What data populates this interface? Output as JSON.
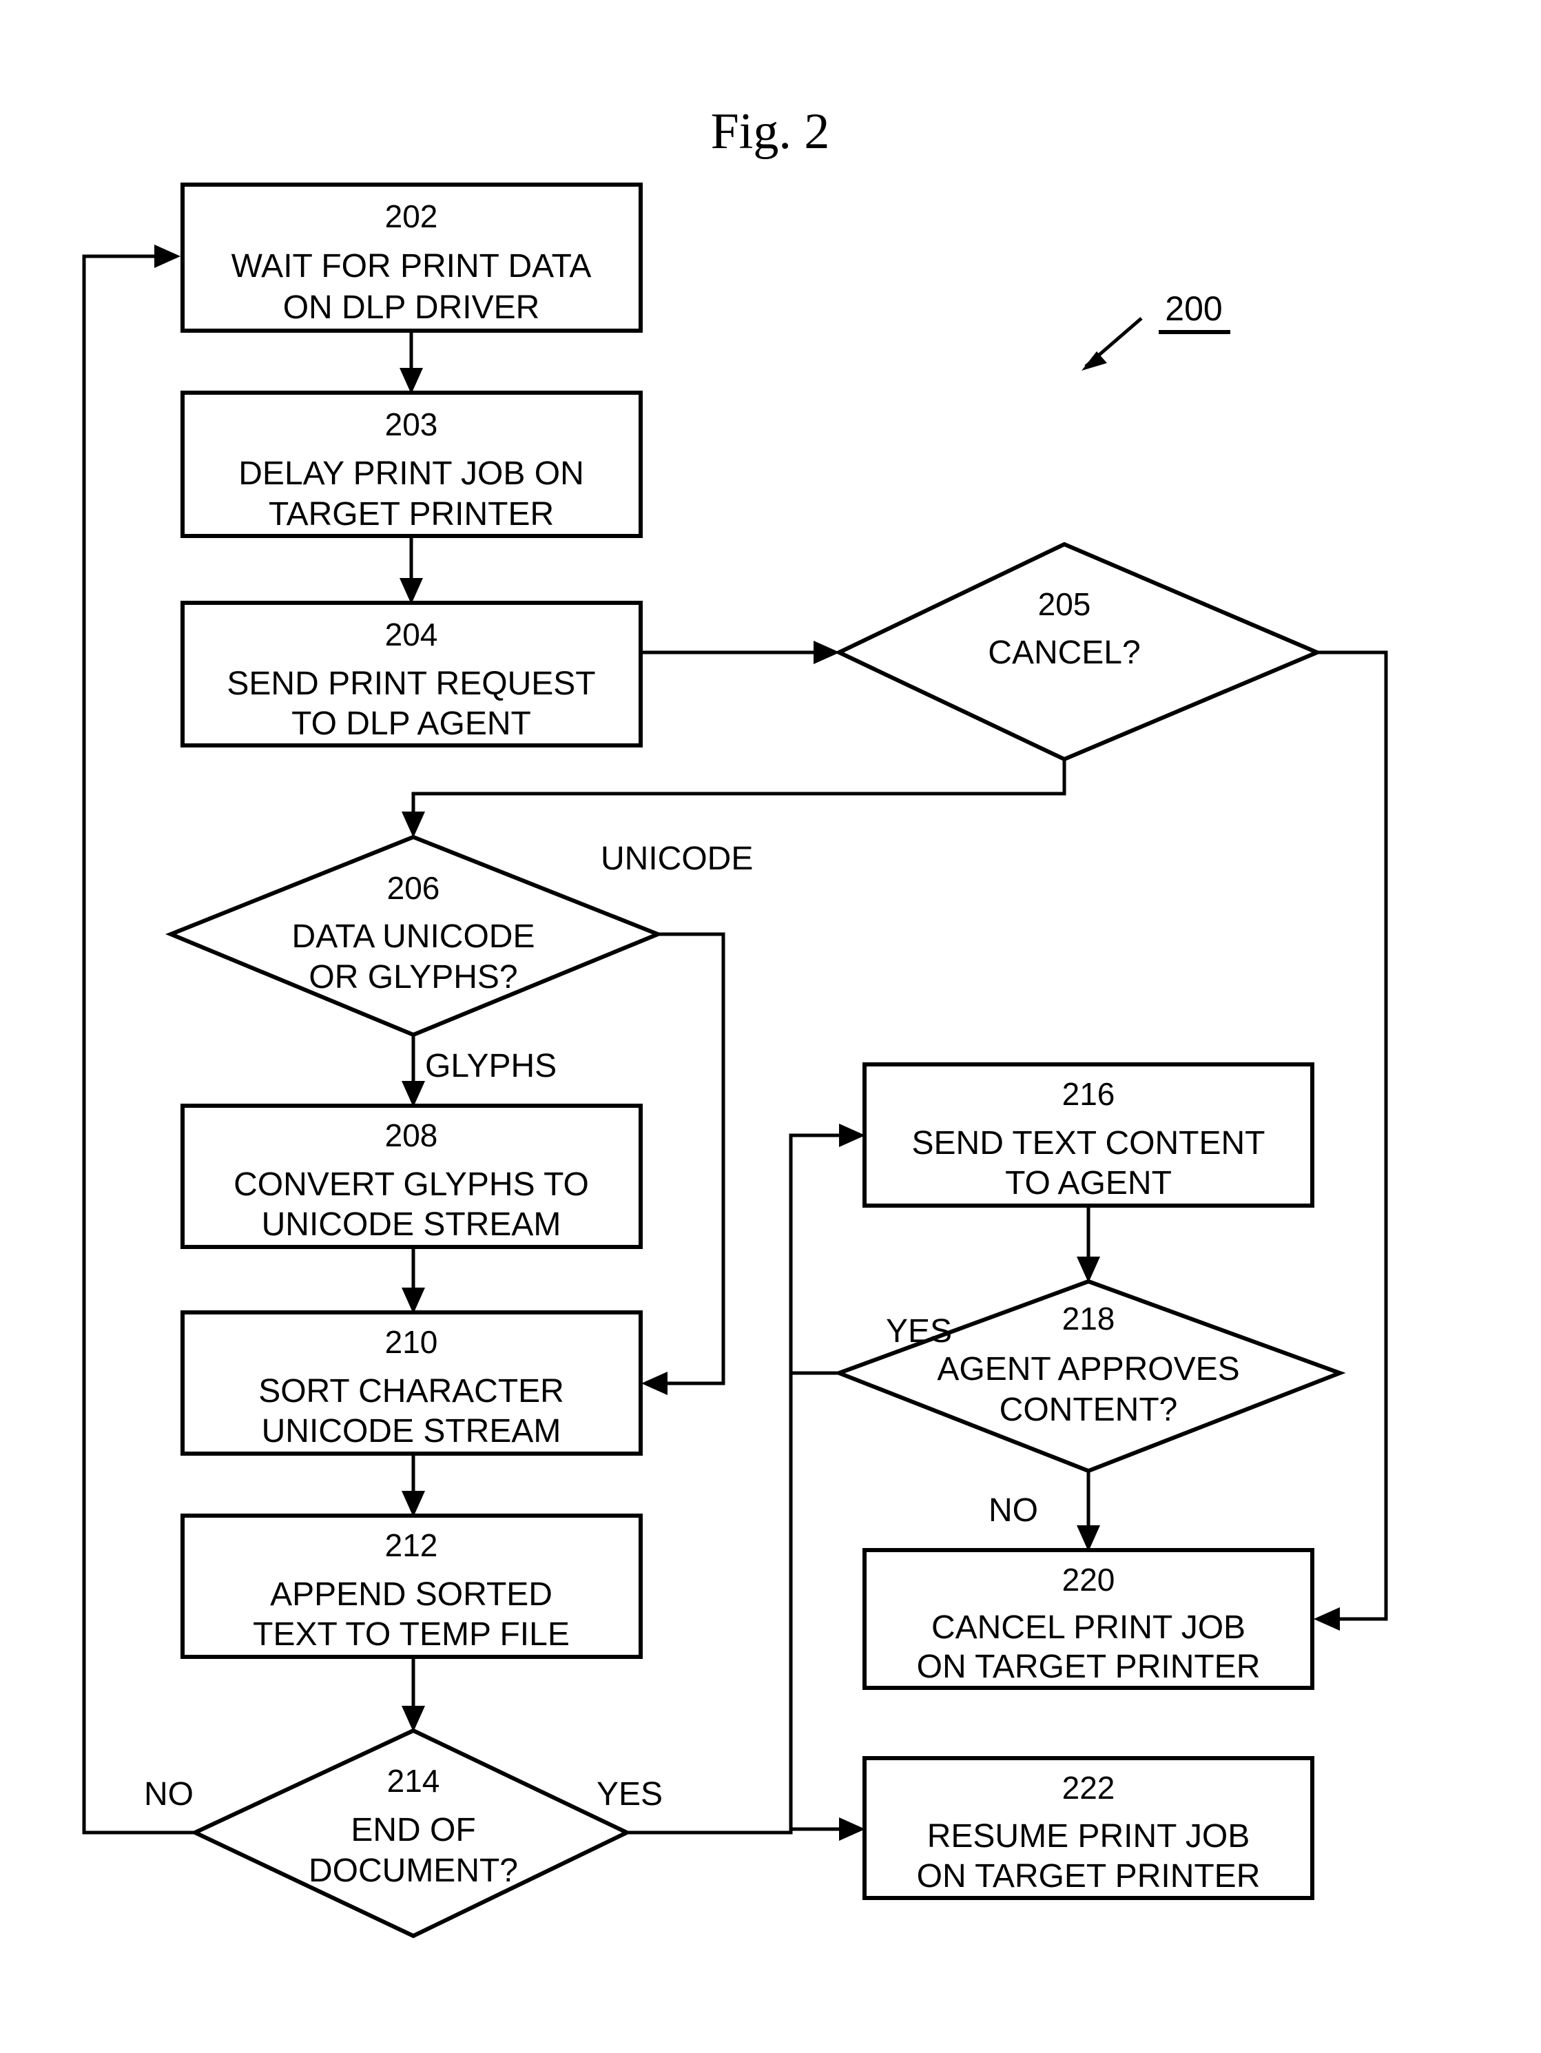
{
  "figure": {
    "title": "Fig. 2",
    "reference_numeral": "200"
  },
  "nodes": {
    "n202": {
      "id": "202",
      "line1": "WAIT FOR PRINT DATA",
      "line2": "ON DLP DRIVER",
      "shape": "process"
    },
    "n203": {
      "id": "203",
      "line1": "DELAY PRINT JOB ON",
      "line2": "TARGET PRINTER",
      "shape": "process"
    },
    "n204": {
      "id": "204",
      "line1": "SEND PRINT REQUEST",
      "line2": "TO DLP AGENT",
      "shape": "process"
    },
    "n205": {
      "id": "205",
      "line1": "CANCEL?",
      "line2": "",
      "shape": "decision"
    },
    "n206": {
      "id": "206",
      "line1": "DATA UNICODE",
      "line2": "OR GLYPHS?",
      "shape": "decision"
    },
    "n208": {
      "id": "208",
      "line1": "CONVERT GLYPHS TO",
      "line2": "UNICODE STREAM",
      "shape": "process"
    },
    "n210": {
      "id": "210",
      "line1": "SORT CHARACTER",
      "line2": "UNICODE STREAM",
      "shape": "process"
    },
    "n212": {
      "id": "212",
      "line1": "APPEND SORTED",
      "line2": "TEXT TO TEMP FILE",
      "shape": "process"
    },
    "n214": {
      "id": "214",
      "line1": "END OF",
      "line2": "DOCUMENT?",
      "shape": "decision"
    },
    "n216": {
      "id": "216",
      "line1": "SEND TEXT CONTENT",
      "line2": "TO AGENT",
      "shape": "process"
    },
    "n218": {
      "id": "218",
      "line1": "AGENT APPROVES",
      "line2": "CONTENT?",
      "shape": "decision"
    },
    "n220": {
      "id": "220",
      "line1": "CANCEL PRINT JOB",
      "line2": "ON TARGET PRINTER",
      "shape": "process"
    },
    "n222": {
      "id": "222",
      "line1": "RESUME PRINT JOB",
      "line2": "ON TARGET PRINTER",
      "shape": "process"
    }
  },
  "edge_labels": {
    "unicode": "UNICODE",
    "glyphs": "GLYPHS",
    "eod_no": "NO",
    "eod_yes": "YES",
    "approve_yes": "YES",
    "approve_no": "NO"
  },
  "colors": {
    "stroke": "#000000",
    "background": "#ffffff",
    "text": "#000000"
  }
}
